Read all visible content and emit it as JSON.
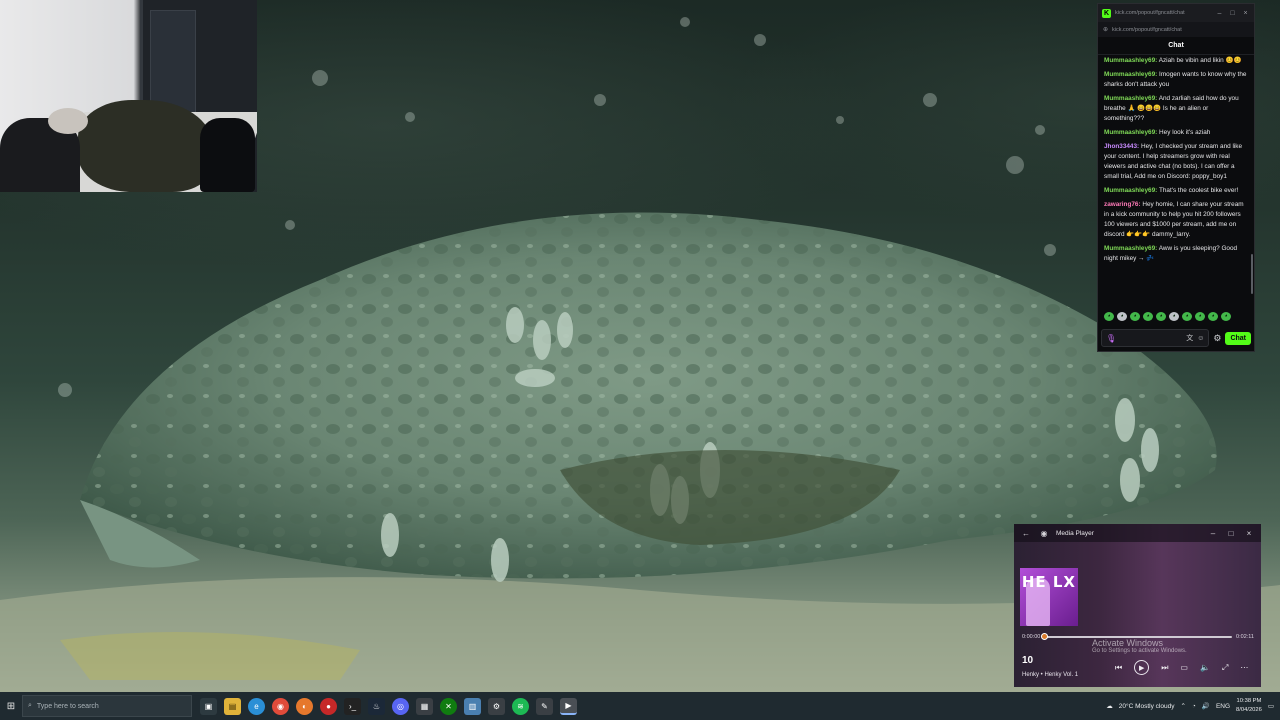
{
  "chat": {
    "window_title": "kick.com/popout/fgncatt/chat",
    "url": "kick.com/popout/fgncatt/chat",
    "header": "Chat",
    "messages": [
      {
        "user": "Mummaashley69:",
        "text": " Aziah be vibin and likin 😊😊",
        "color": "green"
      },
      {
        "user": "Mummaashley69:",
        "text": " Imogen wants to know why the sharks don't attack you",
        "color": "green"
      },
      {
        "user": "Mummaashley69:",
        "text": " And zarliah said how do you breathe 🙏 😄😄😄 Is he an alien or something???",
        "color": "green"
      },
      {
        "user": "Mummaashley69:",
        "text": " Hey look it's aziah",
        "color": "green"
      },
      {
        "user": "Jhon33443:",
        "text": " Hey, I checked your stream and like your content. I help streamers grow with real viewers and active chat (no bots). I can offer a small trial, Add me on Discord: poppy_boy1",
        "color": "purple"
      },
      {
        "user": "Mummaashley69:",
        "text": " That's the coolest bike ever!",
        "color": "green"
      },
      {
        "user": "zawaring76:",
        "text": " Hey homie, I can share your stream in a kick community to help you hit 200 followers 100 viewers and $1000 per stream, add me on discord 👉👉👉 dammy_larry.",
        "color": "pink"
      },
      {
        "user": "Mummaashley69:",
        "text": " Aww is you sleeping? Good night mikey → 💤",
        "color": "green"
      }
    ],
    "send_label": "Chat"
  },
  "media_player": {
    "title": "Media Player",
    "art_text": "HE LX",
    "time_current": "0:00:00",
    "time_total": "0:02:11",
    "progress": 0.0,
    "track_number": "10",
    "track_name": "Henky • Henky Vol. 1",
    "watermark_title": "Activate Windows",
    "watermark_sub": "Go to Settings to activate Windows."
  },
  "taskbar": {
    "search_placeholder": "Type here to search",
    "weather": "20°C  Mostly cloudy",
    "language": "ENG",
    "time": "10:38 PM",
    "date": "8/04/2026"
  },
  "colors": {
    "kick_green": "#53fc18",
    "chat_bg": "#0b0c0e",
    "taskbar_bg": "#1f2a30"
  }
}
